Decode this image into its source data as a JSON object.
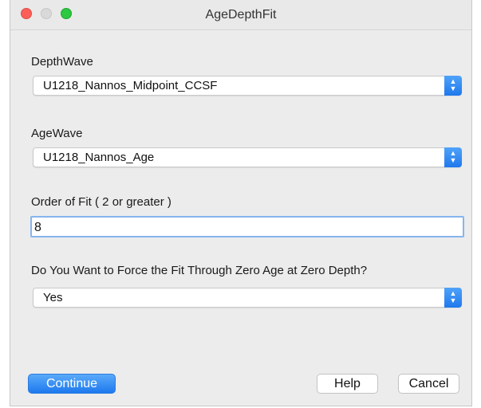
{
  "window": {
    "title": "AgeDepthFit"
  },
  "depth_wave": {
    "label": "DepthWave",
    "value": "U1218_Nannos_Midpoint_CCSF"
  },
  "age_wave": {
    "label": "AgeWave",
    "value": "U1218_Nannos_Age"
  },
  "order_of_fit": {
    "label": "Order of Fit ( 2 or greater )",
    "value": "8"
  },
  "force_zero": {
    "label": "Do You Want to Force the Fit Through Zero Age at Zero Depth?",
    "value": "Yes"
  },
  "buttons": {
    "continue": "Continue",
    "help": "Help",
    "cancel": "Cancel"
  },
  "icons": {
    "popup_arrows": "up-down-chevron-icon"
  },
  "colors": {
    "accent": "#1f78ec",
    "close": "#fc5f57",
    "zoom": "#2bc840"
  }
}
